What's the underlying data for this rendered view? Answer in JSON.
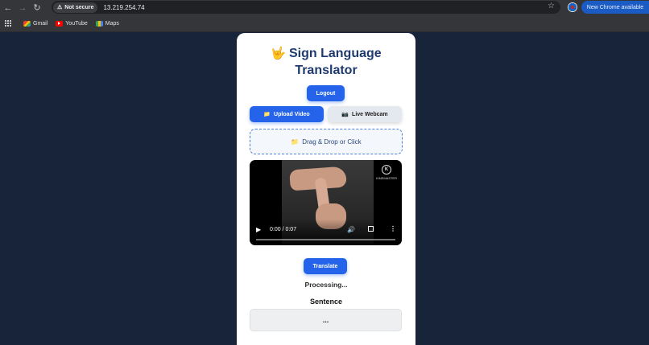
{
  "browser": {
    "security_label": "Not secure",
    "url": "13.219.254.74",
    "update_label": "New Chrome available",
    "bookmarks": [
      {
        "label": "Gmail"
      },
      {
        "label": "YouTube"
      },
      {
        "label": "Maps"
      }
    ]
  },
  "app": {
    "title_icon": "🤟",
    "title_line1": "Sign Language",
    "title_line2": "Translator",
    "logout_label": "Logout",
    "tabs": [
      {
        "icon": "📁",
        "label": "Upload Video",
        "active": true
      },
      {
        "icon": "📷",
        "label": "Live Webcam",
        "active": false
      }
    ],
    "dropzone": {
      "icon": "📁",
      "label": "Drag & Drop or Click"
    },
    "video": {
      "time": "0:00 / 0:07",
      "watermark": "KINEMASTER",
      "progress": 0
    },
    "translate_label": "Translate",
    "status": "Processing...",
    "sentence_label": "Sentence",
    "sentence_value": "..."
  },
  "colors": {
    "page_background": "#17243a",
    "primary": "#2563eb",
    "title": "#1f3a6e"
  }
}
